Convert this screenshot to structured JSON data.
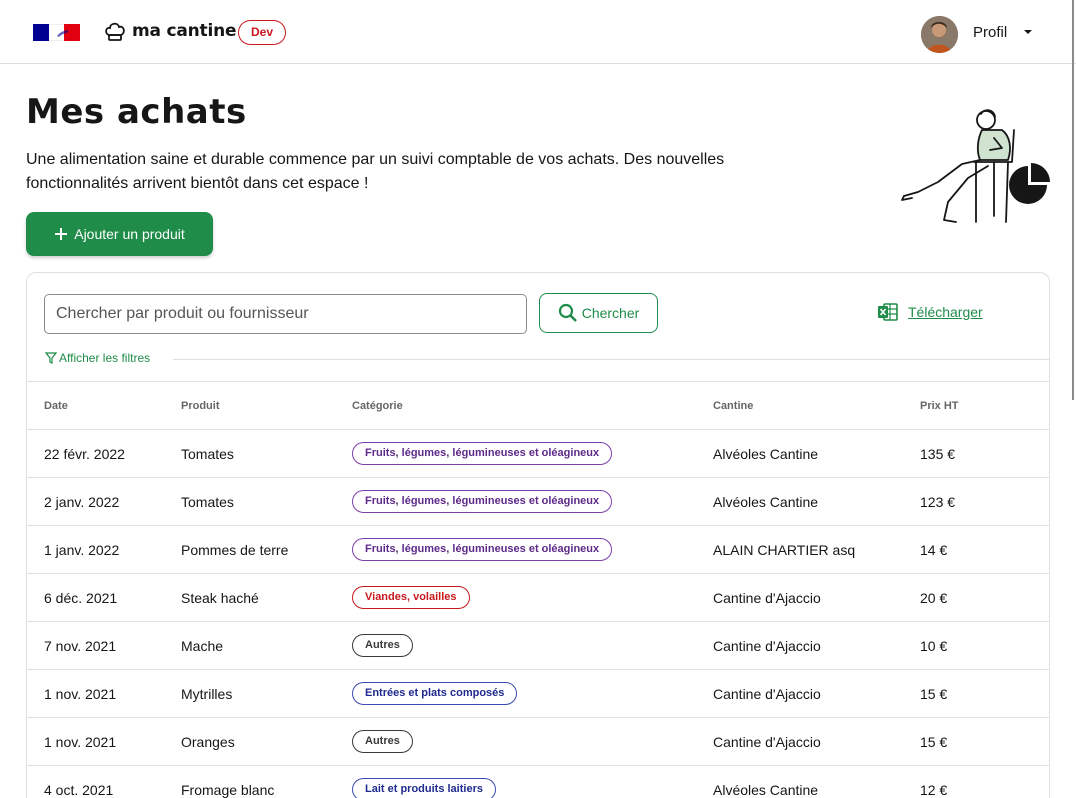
{
  "header": {
    "brand_name": "ma cantine",
    "env_badge": "Dev",
    "profile_label": "Profil"
  },
  "page": {
    "title": "Mes achats",
    "intro": "Une alimentation saine et durable commence par un suivi comptable de vos achats. Des nouvelles fonctionnalités arrivent bientôt dans cet espace !",
    "add_button": "Ajouter un produit"
  },
  "search": {
    "placeholder": "Chercher par produit ou fournisseur",
    "button": "Chercher",
    "download": "Télécharger",
    "filters_toggle": "Afficher les filtres"
  },
  "table": {
    "headers": [
      "Date",
      "Produit",
      "Catégorie",
      "Cantine",
      "Prix HT"
    ],
    "rows": [
      {
        "date": "22 févr. 2022",
        "product": "Tomates",
        "category": "Fruits, légumes, légumineuses et oléagineux",
        "canteen": "Alvéoles Cantine",
        "price": "135 €"
      },
      {
        "date": "2 janv. 2022",
        "product": "Tomates",
        "category": "Fruits, légumes, légumineuses et oléagineux",
        "canteen": "Alvéoles Cantine",
        "price": "123 €"
      },
      {
        "date": "1 janv. 2022",
        "product": "Pommes de terre",
        "category": "Fruits, légumes, légumineuses et oléagineux",
        "canteen": "ALAIN CHARTIER asq",
        "price": "14 €"
      },
      {
        "date": "6 déc. 2021",
        "product": "Steak haché",
        "category": "Viandes, volailles",
        "canteen": "Cantine d'Ajaccio",
        "price": "20 €"
      },
      {
        "date": "7 nov. 2021",
        "product": "Mache",
        "category": "Autres",
        "canteen": "Cantine d'Ajaccio",
        "price": "10 €"
      },
      {
        "date": "1 nov. 2021",
        "product": "Mytrilles",
        "category": "Entrées et plats composés",
        "canteen": "Cantine d'Ajaccio",
        "price": "15 €"
      },
      {
        "date": "1 nov. 2021",
        "product": "Oranges",
        "category": "Autres",
        "canteen": "Cantine d'Ajaccio",
        "price": "15 €"
      },
      {
        "date": "4 oct. 2021",
        "product": "Fromage blanc",
        "category": "Lait et produits laitiers",
        "canteen": "Alvéoles Cantine",
        "price": "12 €"
      }
    ]
  },
  "colors": {
    "primary_green": "#1f8d49",
    "badge_fruits": "#7b3fa8",
    "badge_viandes": "#c9191e",
    "badge_autres": "#3a3a3a",
    "badge_plats": "#3d4ab5"
  }
}
